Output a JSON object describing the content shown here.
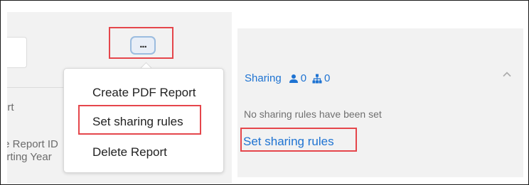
{
  "left_panel": {
    "fragment_report": "ort",
    "fragment_report_id": "te Report ID",
    "fragment_reporting_year": "orting Year"
  },
  "more_button": {
    "label": "..."
  },
  "dropdown_menu": {
    "items": [
      {
        "label": "Create PDF Report"
      },
      {
        "label": "Set sharing rules"
      },
      {
        "label": "Delete Report"
      }
    ]
  },
  "sharing_panel": {
    "title": "Sharing",
    "user_count": "0",
    "group_count": "0",
    "empty_message": "No sharing rules have been set",
    "link_label": "Set sharing rules"
  },
  "colors": {
    "accent": "#1e73d2",
    "highlight": "#e5464b",
    "panel_bg": "#f2f2f2"
  },
  "icons": [
    "more-icon",
    "person-icon",
    "org-chart-icon",
    "chevron-up-icon"
  ]
}
